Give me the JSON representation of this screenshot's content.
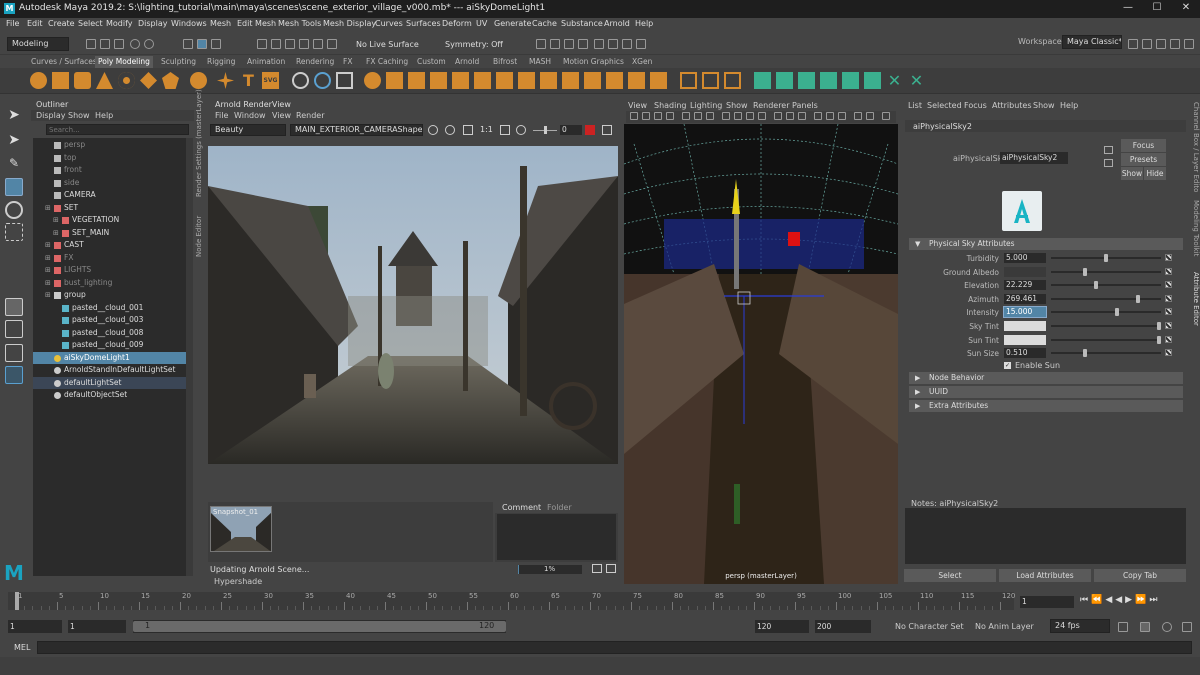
{
  "window": {
    "title": "Autodesk Maya 2019.2: S:\\lighting_tutorial\\main\\maya\\scenes\\scene_exterior_village_v000.mb*  ---  aiSkyDomeLight1"
  },
  "menubar": [
    "File",
    "Edit",
    "Create",
    "Select",
    "Modify",
    "Display",
    "Windows",
    "Mesh",
    "Edit Mesh",
    "Mesh Tools",
    "Mesh Display",
    "Curves",
    "Surfaces",
    "Deform",
    "UV",
    "Generate",
    "Cache",
    "Substance",
    "Arnold",
    "Help"
  ],
  "status": {
    "mode": "Modeling",
    "live_surface": "No Live Surface",
    "symmetry": "Symmetry: Off",
    "workspace_label": "Workspace :",
    "workspace": "Maya Classic*"
  },
  "shelf_tabs": [
    "Curves / Surfaces",
    "Poly Modeling",
    "Sculpting",
    "Rigging",
    "Animation",
    "Rendering",
    "FX",
    "FX Caching",
    "Custom",
    "Arnold",
    "Bifrost",
    "MASH",
    "Motion Graphics",
    "XGen"
  ],
  "shelf_active": "Poly Modeling",
  "outliner": {
    "title": "Outliner",
    "menus": [
      "Display",
      "Show",
      "Help"
    ],
    "search_placeholder": "Search...",
    "items": [
      {
        "label": "persp",
        "indent": 0,
        "dim": true,
        "icon": "camera"
      },
      {
        "label": "top",
        "indent": 0,
        "dim": true,
        "icon": "camera"
      },
      {
        "label": "front",
        "indent": 0,
        "dim": true,
        "icon": "camera"
      },
      {
        "label": "side",
        "indent": 0,
        "dim": true,
        "icon": "camera"
      },
      {
        "label": "CAMERA",
        "indent": 0,
        "dim": false,
        "icon": "camera"
      },
      {
        "label": "SET",
        "indent": 0,
        "dim": false,
        "icon": "set"
      },
      {
        "label": "VEGETATION",
        "indent": 1,
        "dim": false,
        "icon": "set"
      },
      {
        "label": "SET_MAIN",
        "indent": 1,
        "dim": false,
        "icon": "set"
      },
      {
        "label": "CAST",
        "indent": 0,
        "dim": false,
        "icon": "set"
      },
      {
        "label": "FX",
        "indent": 0,
        "dim": true,
        "icon": "set"
      },
      {
        "label": "LIGHTS",
        "indent": 0,
        "dim": true,
        "icon": "set"
      },
      {
        "label": "bust_lighting",
        "indent": 0,
        "dim": true,
        "icon": "set"
      },
      {
        "label": "group",
        "indent": 0,
        "dim": false,
        "icon": "group"
      },
      {
        "label": "pasted__cloud_001",
        "indent": 1,
        "dim": false,
        "icon": "mesh"
      },
      {
        "label": "pasted__cloud_003",
        "indent": 1,
        "dim": false,
        "icon": "mesh"
      },
      {
        "label": "pasted__cloud_008",
        "indent": 1,
        "dim": false,
        "icon": "mesh"
      },
      {
        "label": "pasted__cloud_009",
        "indent": 1,
        "dim": false,
        "icon": "mesh"
      },
      {
        "label": "aiSkyDomeLight1",
        "indent": 0,
        "dim": false,
        "icon": "light",
        "selected": true
      },
      {
        "label": "ArnoldStandInDefaultLightSet",
        "indent": 0,
        "dim": false,
        "icon": "lightset"
      },
      {
        "label": "defaultLightSet",
        "indent": 0,
        "dim": false,
        "icon": "lightset",
        "highlight": true
      },
      {
        "label": "defaultObjectSet",
        "indent": 0,
        "dim": false,
        "icon": "lightset"
      }
    ]
  },
  "side_tabs": {
    "render_settings": "Render Settings (masterLayer)",
    "node_editor": "Node Editor"
  },
  "renderview": {
    "title": "Arnold RenderView",
    "menus": [
      "File",
      "Window",
      "View",
      "Render"
    ],
    "aov": "Beauty",
    "camera": "MAIN_EXTERIOR_CAMERAShape",
    "zoom_ratio": "1:1",
    "exposure": "0",
    "snapshot_label": "Snapshot_01",
    "tabs": [
      "Comment",
      "Folder"
    ],
    "status": "Updating Arnold Scene...",
    "progress": "1%",
    "hypershade": "Hypershade"
  },
  "viewport": {
    "menus": [
      "View",
      "Shading",
      "Lighting",
      "Show",
      "Renderer",
      "Panels"
    ],
    "camera_label": "persp (masterLayer)"
  },
  "attr_editor": {
    "menus": [
      "List",
      "Selected",
      "Focus",
      "Attributes",
      "Show",
      "Help"
    ],
    "tab": "aiPhysicalSky2",
    "node_label": "aiPhysicalSky:",
    "node_value": "aiPhysicalSky2",
    "buttons": {
      "focus": "Focus",
      "presets": "Presets",
      "show": "Show",
      "hide": "Hide"
    },
    "section": "Physical Sky Attributes",
    "attrs": [
      {
        "label": "Turbidity",
        "value": "5.000",
        "slider": 0.5
      },
      {
        "label": "Ground Albedo",
        "value": "",
        "slider": 0.3,
        "color": "#3a3a3a"
      },
      {
        "label": "Elevation",
        "value": "22.229",
        "slider": 0.41
      },
      {
        "label": "Azimuth",
        "value": "269.461",
        "slider": 0.8
      },
      {
        "label": "Intensity",
        "value": "15.000",
        "slider": 0.6,
        "editing": true
      },
      {
        "label": "Sky Tint",
        "value": "",
        "slider": 1.0,
        "color": "#dcdcdc"
      },
      {
        "label": "Sun Tint",
        "value": "",
        "slider": 1.0,
        "color": "#dcdcdc"
      },
      {
        "label": "Sun Size",
        "value": "0.510",
        "slider": 0.3
      }
    ],
    "enable_sun": "Enable Sun",
    "collapsed": [
      "Node Behavior",
      "UUID",
      "Extra Attributes"
    ],
    "notes": "Notes:  aiPhysicalSky2",
    "bottom_buttons": [
      "Select",
      "Load Attributes",
      "Copy Tab"
    ]
  },
  "right_tabs": [
    "Channel Box / Layer Editor",
    "Modeling Toolkit",
    "Attribute Editor"
  ],
  "timeline": {
    "ticks": [
      "1",
      "5",
      "10",
      "15",
      "20",
      "25",
      "30",
      "35",
      "40",
      "45",
      "50",
      "55",
      "60",
      "65",
      "70",
      "75",
      "80",
      "85",
      "90",
      "95",
      "100",
      "105",
      "110",
      "115",
      "120"
    ],
    "current_frame": "1"
  },
  "range": {
    "start": "1",
    "playback_start": "1",
    "range_start_label": "1",
    "range_end_label": "120",
    "playback_end": "120",
    "end": "200",
    "character_set": "No Character Set",
    "anim_layer": "No Anim Layer",
    "fps": "24 fps"
  },
  "command": {
    "label": "MEL"
  }
}
